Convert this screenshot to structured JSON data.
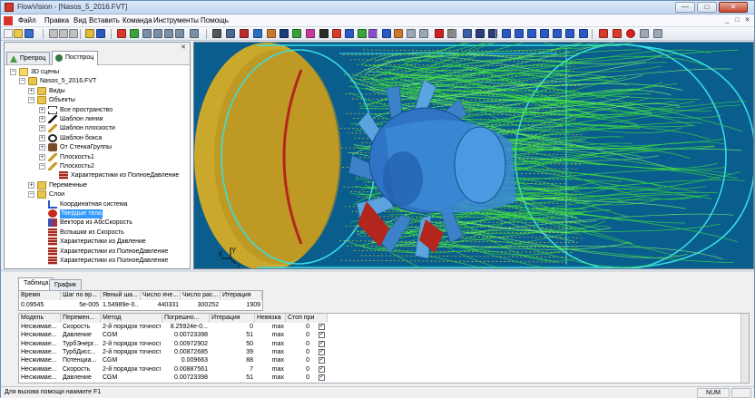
{
  "window": {
    "title": "FlowVision - [Nasos_5_2016.FVT]",
    "minimize": "—",
    "maximize": "□",
    "close": "✕"
  },
  "menu": {
    "items": [
      "Файл",
      "Правка",
      "Вид",
      "Вставить",
      "Команда",
      "Инструменты",
      "Помощь"
    ],
    "mdi": [
      "_",
      "□",
      "✕"
    ]
  },
  "toolbar": {
    "icons": [
      "new-file",
      "open-file",
      "save-file",
      "cut",
      "copy",
      "paste",
      "help",
      "context-help",
      "red-cube",
      "green-cube",
      "cube-a",
      "cube-b",
      "cube-c",
      "cube-d",
      "copy-object",
      "select-cursor",
      "move-rotate",
      "probe",
      "layer-a",
      "layer-b",
      "probe-2",
      "layer-c",
      "layer-d",
      "probe-3",
      "grid-red",
      "grid-blue",
      "grid-green",
      "surface",
      "layer-e",
      "layer-f",
      "copy-a",
      "copy-b",
      "stop",
      "circle",
      "window-a",
      "window-b",
      "fit",
      "rotate-x",
      "rotate-y",
      "rotate-z",
      "ix",
      "iy",
      "iz",
      "axes-flip",
      "record-a",
      "record-b",
      "record-dot",
      "pause",
      "stop-square"
    ]
  },
  "left_panel": {
    "close": "✕",
    "tabs": [
      {
        "label": "Препроц",
        "icon": "preproc-icon"
      },
      {
        "label": "Постпроц",
        "icon": "postproc-icon"
      }
    ],
    "tree": [
      {
        "level": 0,
        "exp": "-",
        "icon": "scene",
        "label": "3D сцены"
      },
      {
        "level": 1,
        "exp": "-",
        "icon": "folder",
        "label": "Nasos_5_2016.FVT"
      },
      {
        "level": 2,
        "exp": "+",
        "icon": "folder",
        "label": "Виды"
      },
      {
        "level": 2,
        "exp": "-",
        "icon": "folder",
        "label": "Объекты"
      },
      {
        "level": 3,
        "exp": "+",
        "icon": "dashed",
        "label": "Все пространство"
      },
      {
        "level": 3,
        "exp": "+",
        "icon": "line",
        "label": "Шаблон линии"
      },
      {
        "level": 3,
        "exp": "+",
        "icon": "plane",
        "label": "Шаблон плоскости"
      },
      {
        "level": 3,
        "exp": "+",
        "icon": "box",
        "label": "Шаблон бокса"
      },
      {
        "level": 3,
        "exp": "+",
        "icon": "group",
        "label": "От СтенкаГруппы"
      },
      {
        "level": 3,
        "exp": "+",
        "icon": "plane",
        "label": "Плоскость1"
      },
      {
        "level": 3,
        "exp": "-",
        "icon": "plane",
        "label": "Плоскость2"
      },
      {
        "level": 4,
        "exp": "",
        "icon": "char",
        "label": "Характеристики из ПолноеДавление"
      },
      {
        "level": 2,
        "exp": "+",
        "icon": "folder",
        "label": "Переменные"
      },
      {
        "level": 2,
        "exp": "-",
        "icon": "folder",
        "label": "Слои"
      },
      {
        "level": 3,
        "exp": "",
        "icon": "axes",
        "label": "Координатная система"
      },
      {
        "level": 3,
        "exp": "",
        "icon": "solid",
        "label": "Твердые тела",
        "selected": true
      },
      {
        "level": 3,
        "exp": "",
        "icon": "vectors",
        "label": "Вектора из АбсСкорость"
      },
      {
        "level": 3,
        "exp": "",
        "icon": "char",
        "label": "Вспышки из Скорость"
      },
      {
        "level": 3,
        "exp": "",
        "icon": "char",
        "label": "Характеристики из Давление"
      },
      {
        "level": 3,
        "exp": "",
        "icon": "char",
        "label": "Характеристики из ПолноеДавление"
      },
      {
        "level": 3,
        "exp": "",
        "icon": "char",
        "label": "Характеристики из ПолноеДавление"
      }
    ]
  },
  "viewport": {
    "axis_y": "Y",
    "axis_x": "X",
    "axis_z": "Z"
  },
  "status_panel": {
    "tabs": [
      "Таблица",
      "График"
    ],
    "top_table": {
      "headers": [
        "Время",
        "Шаг по вр...",
        "Явный ша...",
        "Число яче...",
        "Число рас...",
        "Итерация"
      ],
      "values": [
        "0.09545",
        "5e-005",
        "1.54989e-0...",
        "440331",
        "300252",
        "1909"
      ]
    },
    "bottom_table": {
      "headers": [
        "Модель",
        "Перемен...",
        "Метод",
        "Погрешно...",
        "Итерация",
        "Невязка",
        "Стоп при"
      ],
      "rows": [
        [
          "Несжимае...",
          "Скорость",
          "2-й порядок точности",
          "8.25924e-0...",
          "0",
          "max",
          "0"
        ],
        [
          "Несжимае...",
          "Давление",
          "CGM",
          "0.00723398",
          "51",
          "max",
          "0"
        ],
        [
          "Несжимае...",
          "ТурбЭнерг...",
          "2-й порядок точности",
          "0.00972902",
          "50",
          "max",
          "0"
        ],
        [
          "Несжимае...",
          "ТурбДисс...",
          "2-й порядок точности",
          "0.00872685",
          "39",
          "max",
          "0"
        ],
        [
          "Несжимае...",
          "Потенциа...",
          "CGM",
          "0.009663",
          "88",
          "max",
          "0"
        ],
        [
          "Несжимае...",
          "Скорость",
          "2-й порядок точности",
          "0.00887561",
          "7",
          "max",
          "0"
        ],
        [
          "Несжимае...",
          "Давление",
          "CGM",
          "0.00723398",
          "51",
          "max",
          "0"
        ]
      ]
    }
  },
  "statusbar": {
    "hint": "Для вызова помощи нажмите F1",
    "num": "NUM"
  },
  "colors": {
    "viewport_bg": "#0a6d9c",
    "streamline_green": "#3fe03a",
    "streamline_yellow": "#e6d41c",
    "disc_yellow": "#c9a82b",
    "impeller_blue": "#3b82c8",
    "selection": "#3399ff"
  }
}
